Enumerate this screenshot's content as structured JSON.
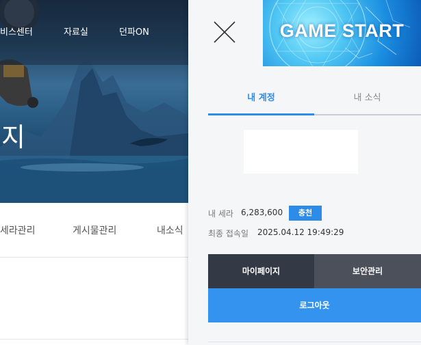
{
  "top_nav": {
    "items": [
      {
        "label": "비스센터"
      },
      {
        "label": "자료실"
      },
      {
        "label": "던파ON"
      }
    ]
  },
  "hero": {
    "title": "지"
  },
  "sub_nav": {
    "items": [
      {
        "label": "세라관리"
      },
      {
        "label": "게시물관리"
      },
      {
        "label": "내소식"
      }
    ]
  },
  "side_panel": {
    "banner": {
      "label": "GAME START"
    },
    "tabs": [
      {
        "label": "내 계정",
        "active": true
      },
      {
        "label": "내 소식",
        "active": false
      }
    ],
    "account": {
      "cera_label": "내 세라",
      "cera_value": "6,283,600",
      "charge_label": "충천",
      "last_login_label": "최종 접속일",
      "last_login_value": "2025.04.12 19:49:29"
    },
    "buttons": {
      "mypage": "마이페이지",
      "security": "보안관리",
      "logout": "로그아웃"
    },
    "icons": {
      "close": "close-icon"
    },
    "colors": {
      "accent": "#2f8be8",
      "logout": "#3593f0",
      "dark_button": "#343a45",
      "dark_button_2": "#4b505b"
    }
  }
}
